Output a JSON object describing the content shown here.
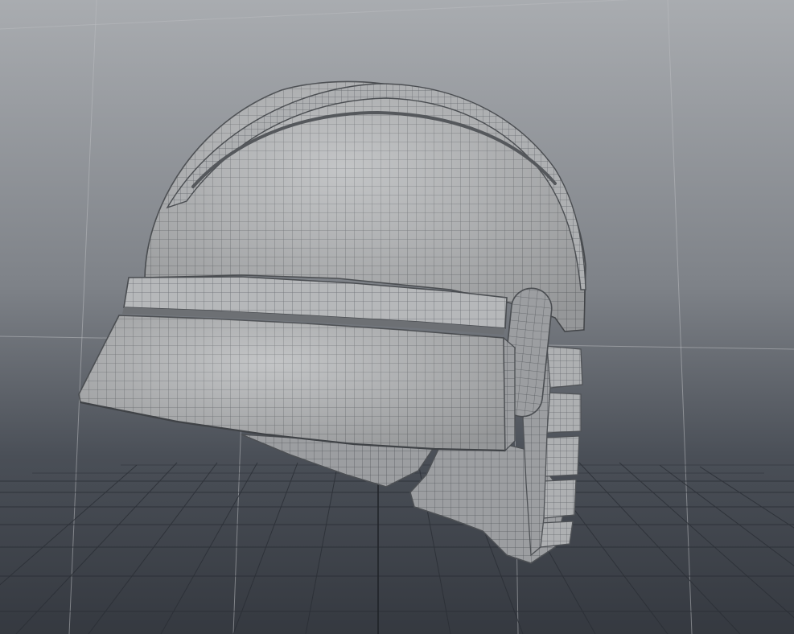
{
  "viewport": {
    "background_top": "#a6a9ad",
    "background_bottom": "#3d4148",
    "floor_grid_color": "#2a2e35",
    "model_surface_color": "#b4b6b8",
    "model_wire_color": "#5c5f63",
    "icons": [
      "viewport-grid",
      "helmet-mesh",
      "world-axis-line"
    ]
  }
}
